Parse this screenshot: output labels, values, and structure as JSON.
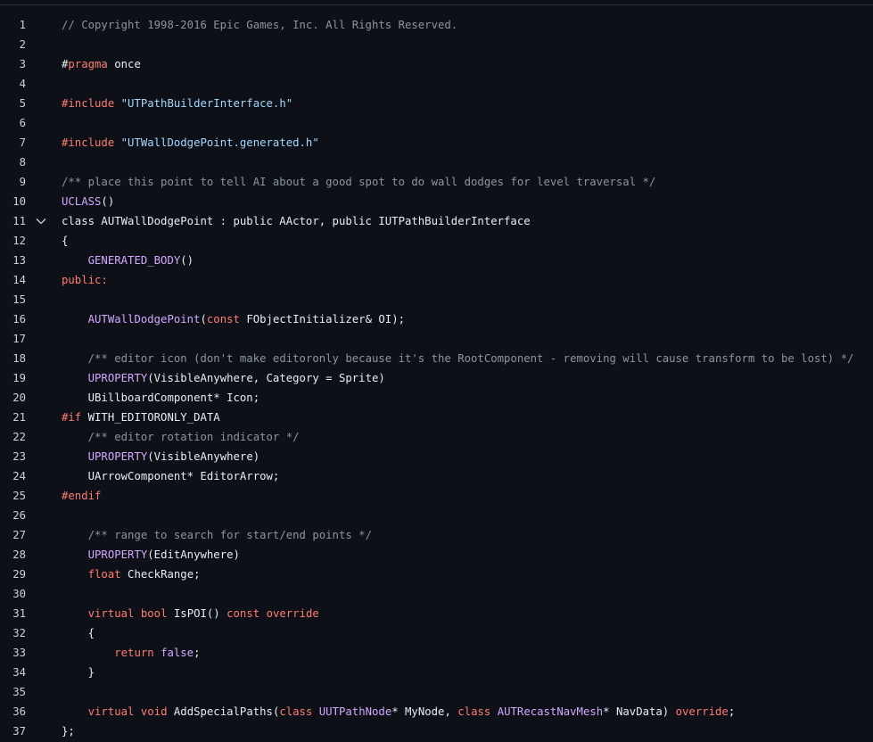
{
  "colors": {
    "background": "#0d1117",
    "plain": "#e6edf3",
    "line_number": "#c9d1d9",
    "comment": "#8b949e",
    "keyword": "#ff7b72",
    "string": "#a5d6ff",
    "macro": "#d2a8ff"
  },
  "lines": [
    {
      "number": "1",
      "indent": 0,
      "tokens": [
        {
          "text": "// Copyright 1998-2016 Epic Games, Inc. All Rights Reserved.",
          "kind": "comment"
        }
      ]
    },
    {
      "number": "2",
      "indent": 0,
      "tokens": []
    },
    {
      "number": "3",
      "indent": 0,
      "tokens": [
        {
          "text": "#",
          "kind": "plain"
        },
        {
          "text": "pragma",
          "kind": "keyword"
        },
        {
          "text": " once",
          "kind": "plain"
        }
      ]
    },
    {
      "number": "4",
      "indent": 0,
      "tokens": []
    },
    {
      "number": "5",
      "indent": 0,
      "tokens": [
        {
          "text": "#include",
          "kind": "keyword"
        },
        {
          "text": " ",
          "kind": "plain"
        },
        {
          "text": "\"UTPathBuilderInterface.h\"",
          "kind": "string"
        }
      ]
    },
    {
      "number": "6",
      "indent": 0,
      "tokens": []
    },
    {
      "number": "7",
      "indent": 0,
      "tokens": [
        {
          "text": "#include",
          "kind": "keyword"
        },
        {
          "text": " ",
          "kind": "plain"
        },
        {
          "text": "\"UTWallDodgePoint.generated.h\"",
          "kind": "string"
        }
      ]
    },
    {
      "number": "8",
      "indent": 0,
      "tokens": []
    },
    {
      "number": "9",
      "indent": 0,
      "tokens": [
        {
          "text": "/** place this point to tell AI about a good spot to do wall dodges for level traversal */",
          "kind": "comment"
        }
      ]
    },
    {
      "number": "10",
      "indent": 0,
      "tokens": [
        {
          "text": "UCLASS",
          "kind": "macro"
        },
        {
          "text": "()",
          "kind": "plain"
        }
      ]
    },
    {
      "number": "11",
      "indent": 0,
      "fold": true,
      "tokens": [
        {
          "text": "class AUTWallDodgePoint : public AActor, public IUTPathBuilderInterface",
          "kind": "plain"
        }
      ]
    },
    {
      "number": "12",
      "indent": 0,
      "tokens": [
        {
          "text": "{",
          "kind": "plain"
        }
      ]
    },
    {
      "number": "13",
      "indent": 1,
      "tokens": [
        {
          "text": "GENERATED_BODY",
          "kind": "macro"
        },
        {
          "text": "()",
          "kind": "plain"
        }
      ]
    },
    {
      "number": "14",
      "indent": 0,
      "tokens": [
        {
          "text": "public:",
          "kind": "keyword"
        }
      ]
    },
    {
      "number": "15",
      "indent": 0,
      "tokens": []
    },
    {
      "number": "16",
      "indent": 1,
      "tokens": [
        {
          "text": "AUTWallDodgePoint",
          "kind": "macro"
        },
        {
          "text": "(",
          "kind": "plain"
        },
        {
          "text": "const",
          "kind": "keyword"
        },
        {
          "text": " FObjectInitializer& OI);",
          "kind": "plain"
        }
      ]
    },
    {
      "number": "17",
      "indent": 0,
      "tokens": []
    },
    {
      "number": "18",
      "indent": 1,
      "tokens": [
        {
          "text": "/** editor icon (don't make editoronly because it's the RootComponent - removing will cause transform to be lost) */",
          "kind": "comment"
        }
      ]
    },
    {
      "number": "19",
      "indent": 1,
      "tokens": [
        {
          "text": "UPROPERTY",
          "kind": "macro"
        },
        {
          "text": "(VisibleAnywhere, Category = Sprite)",
          "kind": "plain"
        }
      ]
    },
    {
      "number": "20",
      "indent": 1,
      "tokens": [
        {
          "text": "UBillboardComponent* Icon;",
          "kind": "plain"
        }
      ]
    },
    {
      "number": "21",
      "indent": 0,
      "tokens": [
        {
          "text": "#if",
          "kind": "keyword"
        },
        {
          "text": " WITH_EDITORONLY_DATA",
          "kind": "plain"
        }
      ]
    },
    {
      "number": "22",
      "indent": 1,
      "tokens": [
        {
          "text": "/** editor rotation indicator */",
          "kind": "comment"
        }
      ]
    },
    {
      "number": "23",
      "indent": 1,
      "tokens": [
        {
          "text": "UPROPERTY",
          "kind": "macro"
        },
        {
          "text": "(VisibleAnywhere)",
          "kind": "plain"
        }
      ]
    },
    {
      "number": "24",
      "indent": 1,
      "tokens": [
        {
          "text": "UArrowComponent* EditorArrow;",
          "kind": "plain"
        }
      ]
    },
    {
      "number": "25",
      "indent": 0,
      "tokens": [
        {
          "text": "#endif",
          "kind": "keyword"
        }
      ]
    },
    {
      "number": "26",
      "indent": 0,
      "tokens": []
    },
    {
      "number": "27",
      "indent": 1,
      "tokens": [
        {
          "text": "/** range to search for start/end points */",
          "kind": "comment"
        }
      ]
    },
    {
      "number": "28",
      "indent": 1,
      "tokens": [
        {
          "text": "UPROPERTY",
          "kind": "macro"
        },
        {
          "text": "(EditAnywhere)",
          "kind": "plain"
        }
      ]
    },
    {
      "number": "29",
      "indent": 1,
      "tokens": [
        {
          "text": "float",
          "kind": "keyword"
        },
        {
          "text": " CheckRange;",
          "kind": "plain"
        }
      ]
    },
    {
      "number": "30",
      "indent": 0,
      "tokens": []
    },
    {
      "number": "31",
      "indent": 1,
      "tokens": [
        {
          "text": "virtual",
          "kind": "keyword"
        },
        {
          "text": " ",
          "kind": "plain"
        },
        {
          "text": "bool",
          "kind": "keyword"
        },
        {
          "text": " IsPOI() ",
          "kind": "plain"
        },
        {
          "text": "const",
          "kind": "keyword"
        },
        {
          "text": " ",
          "kind": "plain"
        },
        {
          "text": "override",
          "kind": "keyword"
        }
      ]
    },
    {
      "number": "32",
      "indent": 1,
      "tokens": [
        {
          "text": "{",
          "kind": "plain"
        }
      ]
    },
    {
      "number": "33",
      "indent": 2,
      "tokens": [
        {
          "text": "return",
          "kind": "keyword"
        },
        {
          "text": " ",
          "kind": "plain"
        },
        {
          "text": "false",
          "kind": "macro"
        },
        {
          "text": ";",
          "kind": "plain"
        }
      ]
    },
    {
      "number": "34",
      "indent": 1,
      "tokens": [
        {
          "text": "}",
          "kind": "plain"
        }
      ]
    },
    {
      "number": "35",
      "indent": 0,
      "tokens": []
    },
    {
      "number": "36",
      "indent": 1,
      "tokens": [
        {
          "text": "virtual",
          "kind": "keyword"
        },
        {
          "text": " ",
          "kind": "plain"
        },
        {
          "text": "void",
          "kind": "keyword"
        },
        {
          "text": " AddSpecialPaths(",
          "kind": "plain"
        },
        {
          "text": "class",
          "kind": "keyword"
        },
        {
          "text": " ",
          "kind": "plain"
        },
        {
          "text": "UUTPathNode",
          "kind": "macro"
        },
        {
          "text": "* MyNode, ",
          "kind": "plain"
        },
        {
          "text": "class",
          "kind": "keyword"
        },
        {
          "text": " ",
          "kind": "plain"
        },
        {
          "text": "AUTRecastNavMesh",
          "kind": "macro"
        },
        {
          "text": "* NavData) ",
          "kind": "plain"
        },
        {
          "text": "override",
          "kind": "keyword"
        },
        {
          "text": ";",
          "kind": "plain"
        }
      ]
    },
    {
      "number": "37",
      "indent": 0,
      "tokens": [
        {
          "text": "};",
          "kind": "plain"
        }
      ]
    }
  ]
}
